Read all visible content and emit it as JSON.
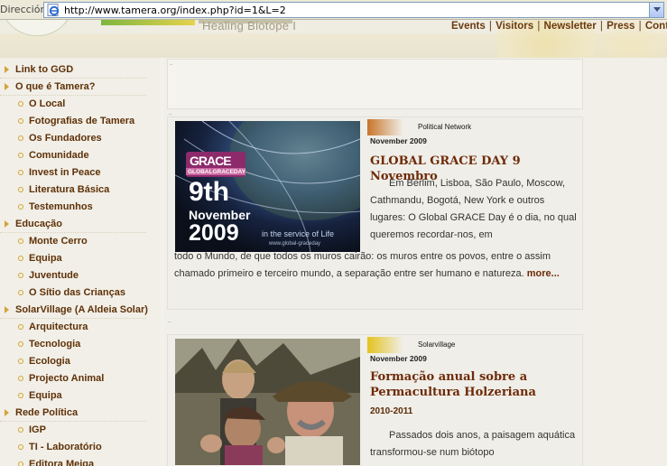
{
  "browser": {
    "address_label": "Dirección",
    "url": "http://www.tamera.org/index.php?id=1&L=2"
  },
  "header": {
    "slogan": "Healing Biotope I",
    "nav": [
      "Events",
      "Visitors",
      "Newsletter",
      "Press",
      "Conta"
    ],
    "separator": "|"
  },
  "sidebar": {
    "items": [
      {
        "label": "Link to GGD",
        "level": "top"
      },
      {
        "label": "O que é Tamera?",
        "level": "top"
      },
      {
        "label": "O Local",
        "level": "sub"
      },
      {
        "label": "Fotografias de Tamera",
        "level": "sub"
      },
      {
        "label": "Os Fundadores",
        "level": "sub"
      },
      {
        "label": "Comunidade",
        "level": "sub"
      },
      {
        "label": "Invest in Peace",
        "level": "sub"
      },
      {
        "label": "Literatura Básica",
        "level": "sub"
      },
      {
        "label": "Testemunhos",
        "level": "sub"
      },
      {
        "label": "Educação",
        "level": "top"
      },
      {
        "label": "Monte Cerro",
        "level": "sub"
      },
      {
        "label": "Equipa",
        "level": "sub"
      },
      {
        "label": "Juventude",
        "level": "sub"
      },
      {
        "label": "O Sítio das Crianças",
        "level": "sub"
      },
      {
        "label": "SolarVillage (A Aldeia Solar)",
        "level": "top"
      },
      {
        "label": "Arquitectura",
        "level": "sub"
      },
      {
        "label": "Tecnologia",
        "level": "sub"
      },
      {
        "label": "Ecologia",
        "level": "sub"
      },
      {
        "label": "Projecto Animal",
        "level": "sub"
      },
      {
        "label": "Equipa",
        "level": "sub"
      },
      {
        "label": "Rede Política",
        "level": "top"
      },
      {
        "label": "IGP",
        "level": "sub"
      },
      {
        "label": "TI - Laboratório",
        "level": "sub"
      },
      {
        "label": "Editora Meiga",
        "level": "sub"
      }
    ]
  },
  "main": {
    "tiny_marker": "..",
    "articles": [
      {
        "category": "Political Network",
        "date": "November 2009",
        "title": "GLOBAL GRACE DAY 9 Novembro",
        "body_right": "Em Berlim, Lisboa, São Paulo, Moscow, Cathmandu, Bogotá, New York e outros lugares: O Global GRACE Day é o dia, no qual queremos recordar-nos, em",
        "body_full": "todo o Mundo, de que todos os muros cairão: os muros entre os povos, entre o assim chamado primeiro e terceiro mundo, a separação entre ser humano e natureza.",
        "more": "more...",
        "image": {
          "logo_text": "GRACE",
          "logo_sub": "GLOBALGRACEDAY",
          "line1": "9th",
          "line2": "November",
          "line3": "2009",
          "caption": "in the service of Life",
          "site": "www.global-graceday"
        }
      },
      {
        "category": "Solarvillage",
        "date": "November 2009",
        "title_line1": "Formação anual sobre a",
        "title_line2": "Permacultura Holzeriana",
        "subdate": "2010-2011",
        "body_right": "Passados dois anos, a paisagem aquática transformou-se num biótopo"
      }
    ]
  },
  "colors": {
    "link_brown": "#5f3108",
    "headline_brown": "#6e2a08",
    "arrow_gold": "#d4a33a",
    "political_grad": "#c8742a",
    "solar_grad": "#e3c21e"
  }
}
